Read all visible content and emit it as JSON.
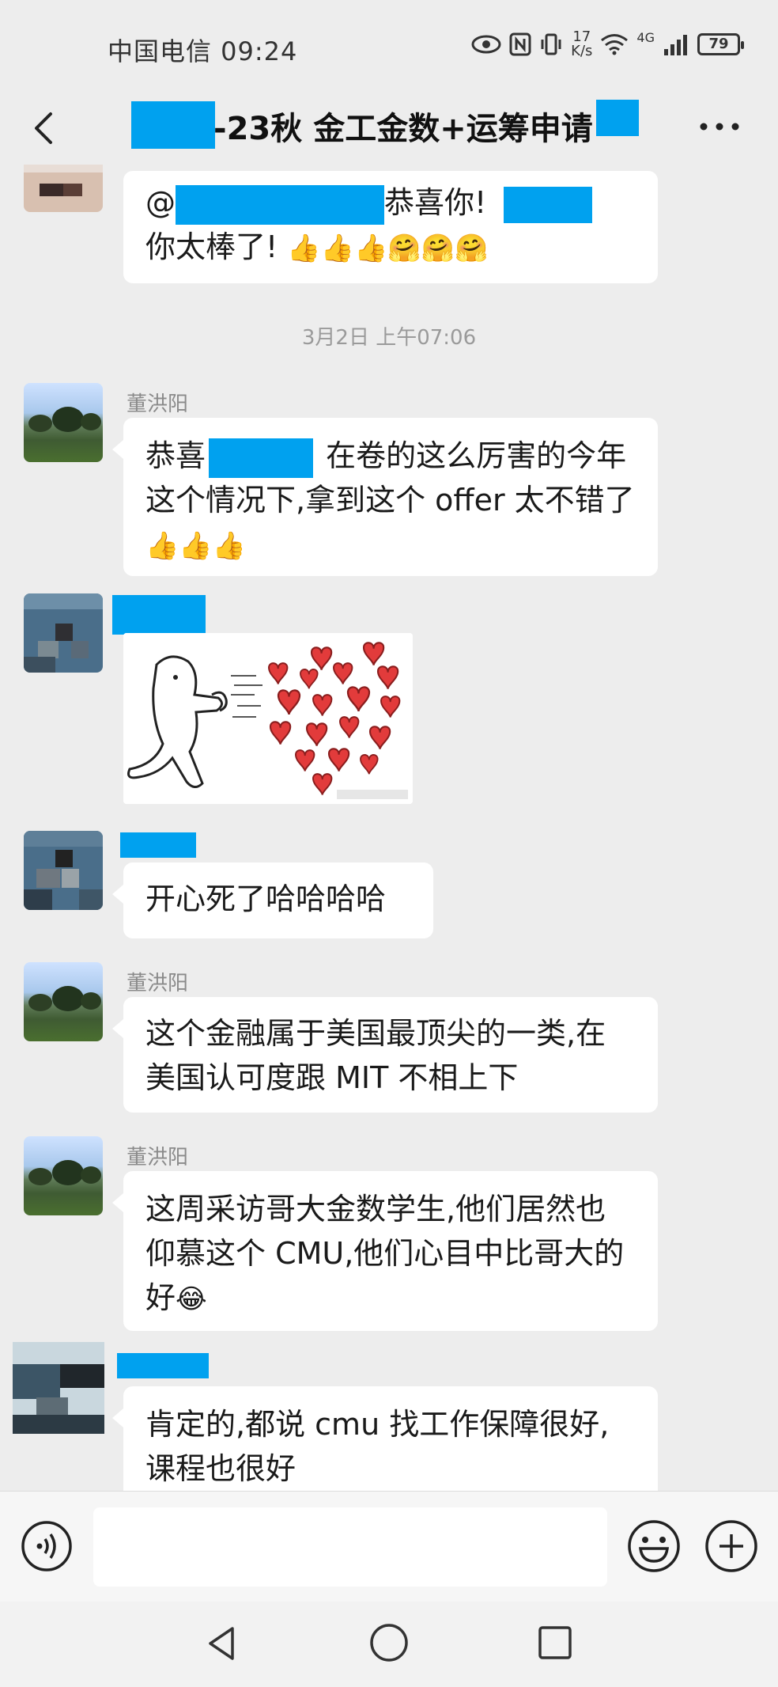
{
  "status_bar": {
    "carrier_time": "中国电信 09:24",
    "net_speed_value": "17",
    "net_speed_unit": "K/s",
    "network_type": "4G",
    "battery": "79"
  },
  "header": {
    "title": "-23秋 金工金数+运筹申请"
  },
  "messages": {
    "m1_text_line1_pre": "@",
    "m1_text_line1_mid": "恭喜你!",
    "m1_text_line2": "你太棒了!",
    "m1_emojis": "👍👍👍🤗🤗🤗",
    "time_divider": "3月2日 上午07:06",
    "m2_sender": "董洪阳",
    "m2_text_pre": "恭喜",
    "m2_text_post": " 在卷的这么厉害的今年这个情况下,拿到这个 offer 太不错了",
    "m2_emojis": "👍👍👍",
    "m4_text": "开心死了哈哈哈哈",
    "m5_sender": "董洪阳",
    "m5_text": "这个金融属于美国最顶尖的一类,在美国认可度跟 MIT 不相上下",
    "m6_sender": "董洪阳",
    "m6_text": "这周采访哥大金数学生,他们居然也仰慕这个 CMU,他们心目中比哥大的好",
    "m6_emoji": "😂",
    "m7_text": "肯定的,都说 cmu 找工作保障很好,课程也很好"
  },
  "icons": {
    "back": "chevron-left-icon",
    "more": "more-horizontal-icon",
    "voice": "voice-icon",
    "emoji": "smiley-icon",
    "plus": "plus-circle-icon",
    "nav_back": "triangle-back-icon",
    "nav_home": "circle-home-icon",
    "nav_recents": "square-recents-icon"
  },
  "colors": {
    "background": "#ededed",
    "bubble": "#ffffff",
    "redaction": "#00a1ef"
  }
}
